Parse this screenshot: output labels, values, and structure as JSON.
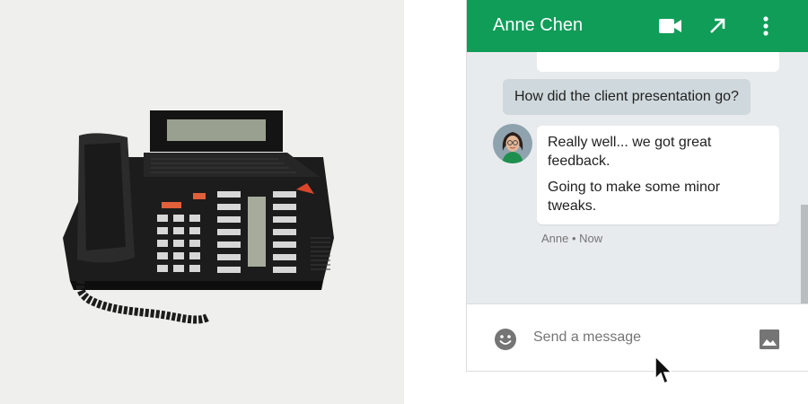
{
  "chat": {
    "contact_name": "Anne Chen",
    "header_actions": [
      "video-call-icon",
      "pop-out-icon",
      "more-vert-icon"
    ],
    "messages": [
      {
        "direction": "outgoing",
        "text": "How did the client presentation go?"
      },
      {
        "direction": "incoming",
        "lines": [
          "Really well... we got great feedback.",
          "Going to make some minor tweaks."
        ]
      }
    ],
    "incoming_meta": "Anne • Now",
    "composer": {
      "placeholder": "Send a message",
      "value": "",
      "left_icon": "emoji-icon",
      "right_icon": "image-icon"
    }
  },
  "colors": {
    "header": "#0f9d58",
    "outgoing_bubble": "#cfd8dc",
    "incoming_bubble": "#ffffff",
    "messages_background": "#e8ebee",
    "left_panel_background": "#efefed"
  }
}
